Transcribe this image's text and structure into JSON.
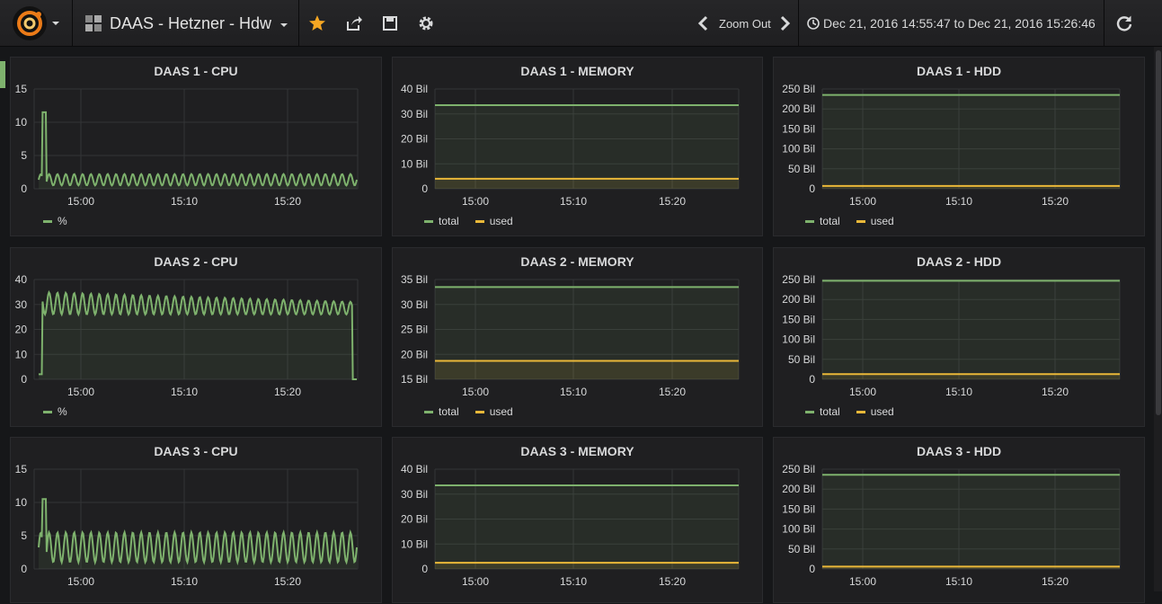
{
  "header": {
    "dashboard_title": "DAAS - Hetzner - Hdw",
    "zoom_out_label": "Zoom Out",
    "time_range": "Dec 21, 2016 14:55:47 to Dec 21, 2016 15:26:46"
  },
  "colors": {
    "total": "#7eb26d",
    "used": "#eab839",
    "accent": "#eb7b18"
  },
  "icons": [
    "grafana-logo-icon",
    "dashboard-grid-icon",
    "star-icon",
    "share-icon",
    "save-icon",
    "gear-icon",
    "chevron-left-icon",
    "chevron-right-icon",
    "clock-icon",
    "refresh-icon"
  ],
  "panels": [
    {
      "title": "DAAS 1 - CPU",
      "y_ticks": [
        "15",
        "10",
        "5",
        "0"
      ],
      "x_ticks": [
        "15:00",
        "15:10",
        "15:20"
      ],
      "legend": [
        {
          "label": "%"
        }
      ]
    },
    {
      "title": "DAAS 1 - MEMORY",
      "y_ticks": [
        "40 Bil",
        "30 Bil",
        "20 Bil",
        "10 Bil",
        "0"
      ],
      "x_ticks": [
        "15:00",
        "15:10",
        "15:20"
      ],
      "legend": [
        {
          "label": "total"
        },
        {
          "label": "used"
        }
      ]
    },
    {
      "title": "DAAS 1 - HDD",
      "y_ticks": [
        "250 Bil",
        "200 Bil",
        "150 Bil",
        "100 Bil",
        "50 Bil",
        "0"
      ],
      "x_ticks": [
        "15:00",
        "15:10",
        "15:20"
      ],
      "legend": [
        {
          "label": "total"
        },
        {
          "label": "used"
        }
      ]
    },
    {
      "title": "DAAS 2 - CPU",
      "y_ticks": [
        "40",
        "30",
        "20",
        "10",
        "0"
      ],
      "x_ticks": [
        "15:00",
        "15:10",
        "15:20"
      ],
      "legend": [
        {
          "label": "%"
        }
      ]
    },
    {
      "title": "DAAS 2 - MEMORY",
      "y_ticks": [
        "35 Bil",
        "30 Bil",
        "25 Bil",
        "20 Bil",
        "15 Bil"
      ],
      "x_ticks": [
        "15:00",
        "15:10",
        "15:20"
      ],
      "legend": [
        {
          "label": "total"
        },
        {
          "label": "used"
        }
      ]
    },
    {
      "title": "DAAS 2 - HDD",
      "y_ticks": [
        "250 Bil",
        "200 Bil",
        "150 Bil",
        "100 Bil",
        "50 Bil",
        "0"
      ],
      "x_ticks": [
        "15:00",
        "15:10",
        "15:20"
      ],
      "legend": [
        {
          "label": "total"
        },
        {
          "label": "used"
        }
      ]
    },
    {
      "title": "DAAS 3 - CPU",
      "y_ticks": [
        "15",
        "10",
        "5",
        "0"
      ],
      "x_ticks": [
        "15:00",
        "15:10",
        "15:20"
      ],
      "legend": []
    },
    {
      "title": "DAAS 3 - MEMORY",
      "y_ticks": [
        "40 Bil",
        "30 Bil",
        "20 Bil",
        "10 Bil",
        "0"
      ],
      "x_ticks": [
        "15:00",
        "15:10",
        "15:20"
      ],
      "legend": []
    },
    {
      "title": "DAAS 3 - HDD",
      "y_ticks": [
        "250 Bil",
        "200 Bil",
        "150 Bil",
        "100 Bil",
        "50 Bil",
        "0"
      ],
      "x_ticks": [
        "15:00",
        "15:10",
        "15:20"
      ],
      "legend": []
    }
  ],
  "chart_data": [
    {
      "type": "line",
      "title": "DAAS 1 - CPU",
      "ylim": [
        0,
        15
      ],
      "x": "time 14:55:47–15:26:46",
      "series": [
        {
          "name": "%",
          "shape": "spike",
          "base": 0.5,
          "peak": 2.2,
          "spike": 11.5,
          "cycles": 38
        }
      ]
    },
    {
      "type": "area",
      "title": "DAAS 1 - MEMORY",
      "ylim": [
        0,
        40
      ],
      "unit": "Bil",
      "series": [
        {
          "name": "total",
          "values": [
            33.5,
            33.5
          ]
        },
        {
          "name": "used",
          "values": [
            4,
            4
          ]
        }
      ]
    },
    {
      "type": "area",
      "title": "DAAS 1 - HDD",
      "ylim": [
        0,
        250
      ],
      "unit": "Bil",
      "series": [
        {
          "name": "total",
          "values": [
            235,
            235
          ]
        },
        {
          "name": "used",
          "values": [
            7,
            7
          ]
        }
      ]
    },
    {
      "type": "line",
      "title": "DAAS 2 - CPU",
      "ylim": [
        0,
        40
      ],
      "series": [
        {
          "name": "%",
          "shape": "osc",
          "base": 26,
          "peak": 35,
          "end_peak": 31,
          "cycles": 38
        }
      ]
    },
    {
      "type": "area",
      "title": "DAAS 2 - MEMORY",
      "ylim": [
        15,
        35
      ],
      "unit": "Bil",
      "series": [
        {
          "name": "total",
          "values": [
            33.5,
            33.5
          ]
        },
        {
          "name": "used",
          "values": [
            18.7,
            18.7
          ]
        }
      ]
    },
    {
      "type": "area",
      "title": "DAAS 2 - HDD",
      "ylim": [
        0,
        250
      ],
      "unit": "Bil",
      "series": [
        {
          "name": "total",
          "values": [
            247,
            247
          ]
        },
        {
          "name": "used",
          "values": [
            13,
            13
          ]
        }
      ]
    },
    {
      "type": "line",
      "title": "DAAS 3 - CPU",
      "ylim": [
        0,
        15
      ],
      "series": [
        {
          "name": "%",
          "shape": "spike",
          "base": 1,
          "peak": 5.5,
          "spike": 10.5,
          "cycles": 38
        }
      ]
    },
    {
      "type": "area",
      "title": "DAAS 3 - MEMORY",
      "ylim": [
        0,
        40
      ],
      "unit": "Bil",
      "series": [
        {
          "name": "total",
          "values": [
            33.5,
            33.5
          ]
        },
        {
          "name": "used",
          "values": [
            2.5,
            2.5
          ]
        }
      ]
    },
    {
      "type": "area",
      "title": "DAAS 3 - HDD",
      "ylim": [
        0,
        250
      ],
      "unit": "Bil",
      "series": [
        {
          "name": "total",
          "values": [
            236,
            236
          ]
        },
        {
          "name": "used",
          "values": [
            6,
            6
          ]
        }
      ]
    }
  ]
}
